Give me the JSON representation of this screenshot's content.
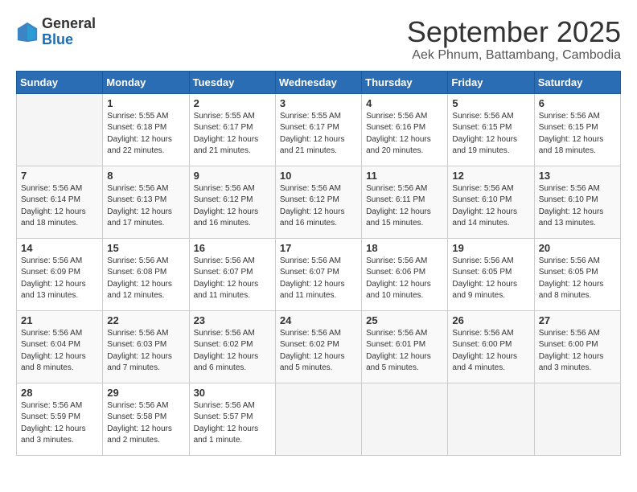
{
  "logo": {
    "general": "General",
    "blue": "Blue"
  },
  "title": "September 2025",
  "subtitle": "Aek Phnum, Battambang, Cambodia",
  "days_of_week": [
    "Sunday",
    "Monday",
    "Tuesday",
    "Wednesday",
    "Thursday",
    "Friday",
    "Saturday"
  ],
  "weeks": [
    [
      {
        "day": "",
        "sunrise": "",
        "sunset": "",
        "daylight": ""
      },
      {
        "day": "1",
        "sunrise": "Sunrise: 5:55 AM",
        "sunset": "Sunset: 6:18 PM",
        "daylight": "Daylight: 12 hours and 22 minutes."
      },
      {
        "day": "2",
        "sunrise": "Sunrise: 5:55 AM",
        "sunset": "Sunset: 6:17 PM",
        "daylight": "Daylight: 12 hours and 21 minutes."
      },
      {
        "day": "3",
        "sunrise": "Sunrise: 5:55 AM",
        "sunset": "Sunset: 6:17 PM",
        "daylight": "Daylight: 12 hours and 21 minutes."
      },
      {
        "day": "4",
        "sunrise": "Sunrise: 5:56 AM",
        "sunset": "Sunset: 6:16 PM",
        "daylight": "Daylight: 12 hours and 20 minutes."
      },
      {
        "day": "5",
        "sunrise": "Sunrise: 5:56 AM",
        "sunset": "Sunset: 6:15 PM",
        "daylight": "Daylight: 12 hours and 19 minutes."
      },
      {
        "day": "6",
        "sunrise": "Sunrise: 5:56 AM",
        "sunset": "Sunset: 6:15 PM",
        "daylight": "Daylight: 12 hours and 18 minutes."
      }
    ],
    [
      {
        "day": "7",
        "sunrise": "Sunrise: 5:56 AM",
        "sunset": "Sunset: 6:14 PM",
        "daylight": "Daylight: 12 hours and 18 minutes."
      },
      {
        "day": "8",
        "sunrise": "Sunrise: 5:56 AM",
        "sunset": "Sunset: 6:13 PM",
        "daylight": "Daylight: 12 hours and 17 minutes."
      },
      {
        "day": "9",
        "sunrise": "Sunrise: 5:56 AM",
        "sunset": "Sunset: 6:12 PM",
        "daylight": "Daylight: 12 hours and 16 minutes."
      },
      {
        "day": "10",
        "sunrise": "Sunrise: 5:56 AM",
        "sunset": "Sunset: 6:12 PM",
        "daylight": "Daylight: 12 hours and 16 minutes."
      },
      {
        "day": "11",
        "sunrise": "Sunrise: 5:56 AM",
        "sunset": "Sunset: 6:11 PM",
        "daylight": "Daylight: 12 hours and 15 minutes."
      },
      {
        "day": "12",
        "sunrise": "Sunrise: 5:56 AM",
        "sunset": "Sunset: 6:10 PM",
        "daylight": "Daylight: 12 hours and 14 minutes."
      },
      {
        "day": "13",
        "sunrise": "Sunrise: 5:56 AM",
        "sunset": "Sunset: 6:10 PM",
        "daylight": "Daylight: 12 hours and 13 minutes."
      }
    ],
    [
      {
        "day": "14",
        "sunrise": "Sunrise: 5:56 AM",
        "sunset": "Sunset: 6:09 PM",
        "daylight": "Daylight: 12 hours and 13 minutes."
      },
      {
        "day": "15",
        "sunrise": "Sunrise: 5:56 AM",
        "sunset": "Sunset: 6:08 PM",
        "daylight": "Daylight: 12 hours and 12 minutes."
      },
      {
        "day": "16",
        "sunrise": "Sunrise: 5:56 AM",
        "sunset": "Sunset: 6:07 PM",
        "daylight": "Daylight: 12 hours and 11 minutes."
      },
      {
        "day": "17",
        "sunrise": "Sunrise: 5:56 AM",
        "sunset": "Sunset: 6:07 PM",
        "daylight": "Daylight: 12 hours and 11 minutes."
      },
      {
        "day": "18",
        "sunrise": "Sunrise: 5:56 AM",
        "sunset": "Sunset: 6:06 PM",
        "daylight": "Daylight: 12 hours and 10 minutes."
      },
      {
        "day": "19",
        "sunrise": "Sunrise: 5:56 AM",
        "sunset": "Sunset: 6:05 PM",
        "daylight": "Daylight: 12 hours and 9 minutes."
      },
      {
        "day": "20",
        "sunrise": "Sunrise: 5:56 AM",
        "sunset": "Sunset: 6:05 PM",
        "daylight": "Daylight: 12 hours and 8 minutes."
      }
    ],
    [
      {
        "day": "21",
        "sunrise": "Sunrise: 5:56 AM",
        "sunset": "Sunset: 6:04 PM",
        "daylight": "Daylight: 12 hours and 8 minutes."
      },
      {
        "day": "22",
        "sunrise": "Sunrise: 5:56 AM",
        "sunset": "Sunset: 6:03 PM",
        "daylight": "Daylight: 12 hours and 7 minutes."
      },
      {
        "day": "23",
        "sunrise": "Sunrise: 5:56 AM",
        "sunset": "Sunset: 6:02 PM",
        "daylight": "Daylight: 12 hours and 6 minutes."
      },
      {
        "day": "24",
        "sunrise": "Sunrise: 5:56 AM",
        "sunset": "Sunset: 6:02 PM",
        "daylight": "Daylight: 12 hours and 5 minutes."
      },
      {
        "day": "25",
        "sunrise": "Sunrise: 5:56 AM",
        "sunset": "Sunset: 6:01 PM",
        "daylight": "Daylight: 12 hours and 5 minutes."
      },
      {
        "day": "26",
        "sunrise": "Sunrise: 5:56 AM",
        "sunset": "Sunset: 6:00 PM",
        "daylight": "Daylight: 12 hours and 4 minutes."
      },
      {
        "day": "27",
        "sunrise": "Sunrise: 5:56 AM",
        "sunset": "Sunset: 6:00 PM",
        "daylight": "Daylight: 12 hours and 3 minutes."
      }
    ],
    [
      {
        "day": "28",
        "sunrise": "Sunrise: 5:56 AM",
        "sunset": "Sunset: 5:59 PM",
        "daylight": "Daylight: 12 hours and 3 minutes."
      },
      {
        "day": "29",
        "sunrise": "Sunrise: 5:56 AM",
        "sunset": "Sunset: 5:58 PM",
        "daylight": "Daylight: 12 hours and 2 minutes."
      },
      {
        "day": "30",
        "sunrise": "Sunrise: 5:56 AM",
        "sunset": "Sunset: 5:57 PM",
        "daylight": "Daylight: 12 hours and 1 minute."
      },
      {
        "day": "",
        "sunrise": "",
        "sunset": "",
        "daylight": ""
      },
      {
        "day": "",
        "sunrise": "",
        "sunset": "",
        "daylight": ""
      },
      {
        "day": "",
        "sunrise": "",
        "sunset": "",
        "daylight": ""
      },
      {
        "day": "",
        "sunrise": "",
        "sunset": "",
        "daylight": ""
      }
    ]
  ]
}
